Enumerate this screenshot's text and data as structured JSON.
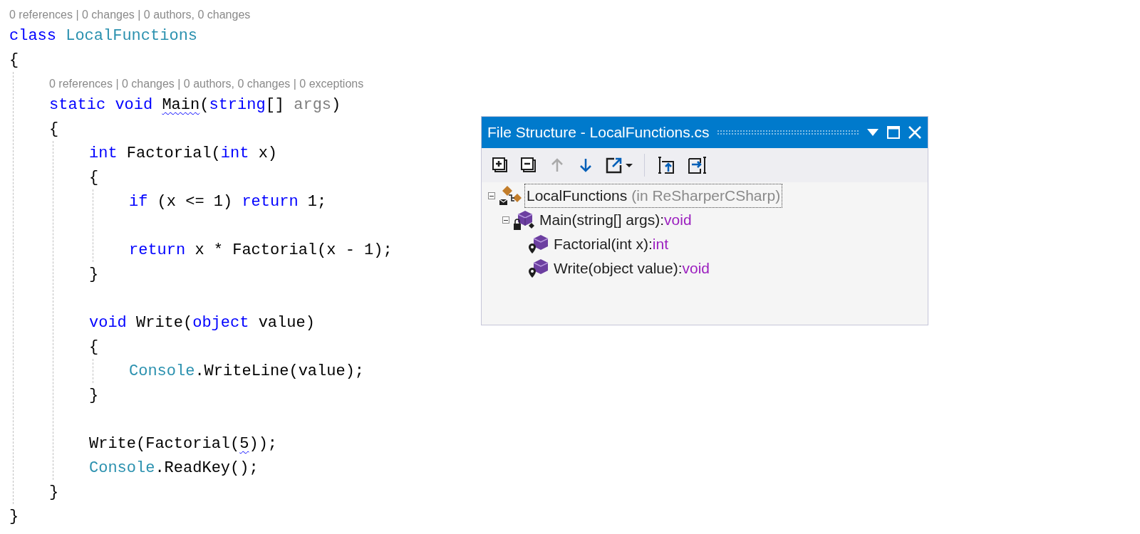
{
  "editor": {
    "lines": [
      {
        "kind": "lens",
        "text": "0 references | 0 changes | 0 authors, 0 changes"
      },
      {
        "kind": "code",
        "tokens": [
          {
            "text": "class",
            "kind": "keyword"
          },
          {
            "text": "LocalFunctions",
            "kind": "type",
            "space": true
          }
        ]
      },
      {
        "kind": "code",
        "tokens": [
          {
            "text": "{"
          }
        ]
      },
      {
        "kind": "block",
        "children": [
          {
            "kind": "lens",
            "text": "0 references | 0 changes | 0 authors, 0 changes | 0 exceptions"
          },
          {
            "kind": "code",
            "tokens": [
              {
                "text": "static void",
                "kind": "keyword"
              },
              {
                "text": "Main",
                "squiggle": true,
                "space": true
              },
              {
                "text": "("
              },
              {
                "text": "string",
                "kind": "keyword"
              },
              {
                "text": "[]"
              },
              {
                "text": "args",
                "kind": "unused",
                "space": true
              },
              {
                "text": ")"
              }
            ]
          },
          {
            "kind": "code",
            "tokens": [
              {
                "text": "{"
              }
            ]
          },
          {
            "kind": "block",
            "children": [
              {
                "kind": "code",
                "tokens": [
                  {
                    "text": "int",
                    "kind": "keyword"
                  },
                  {
                    "text": "Factorial(",
                    "space": true
                  },
                  {
                    "text": "int",
                    "kind": "keyword"
                  },
                  {
                    "text": "x)",
                    "space": true
                  }
                ]
              },
              {
                "kind": "code",
                "tokens": [
                  {
                    "text": "{"
                  }
                ]
              },
              {
                "kind": "block",
                "children": [
                  {
                    "kind": "code",
                    "tokens": [
                      {
                        "text": "if",
                        "kind": "keyword"
                      },
                      {
                        "text": "(x <= 1)",
                        "space": true
                      },
                      {
                        "text": "return",
                        "kind": "keyword",
                        "space": true
                      },
                      {
                        "text": "1;",
                        "space": true
                      }
                    ]
                  },
                  {
                    "kind": "blank"
                  },
                  {
                    "kind": "code",
                    "tokens": [
                      {
                        "text": "return",
                        "kind": "keyword"
                      },
                      {
                        "text": "x * Factorial(x - 1);",
                        "space": true
                      }
                    ]
                  }
                ]
              },
              {
                "kind": "code",
                "tokens": [
                  {
                    "text": "}"
                  }
                ]
              },
              {
                "kind": "blank"
              },
              {
                "kind": "code",
                "tokens": [
                  {
                    "text": "void",
                    "kind": "keyword"
                  },
                  {
                    "text": "Write(",
                    "space": true
                  },
                  {
                    "text": "object",
                    "kind": "keyword"
                  },
                  {
                    "text": "value)",
                    "space": true
                  }
                ]
              },
              {
                "kind": "code",
                "tokens": [
                  {
                    "text": "{"
                  }
                ]
              },
              {
                "kind": "block",
                "children": [
                  {
                    "kind": "code",
                    "tokens": [
                      {
                        "text": "Console",
                        "kind": "type"
                      },
                      {
                        "text": ".WriteLine(value);"
                      }
                    ]
                  }
                ]
              },
              {
                "kind": "code",
                "tokens": [
                  {
                    "text": "}"
                  }
                ]
              },
              {
                "kind": "blank"
              },
              {
                "kind": "code",
                "tokens": [
                  {
                    "text": "Write(Factorial("
                  },
                  {
                    "text": "5",
                    "squiggle": true
                  },
                  {
                    "text": "));"
                  }
                ]
              },
              {
                "kind": "code",
                "tokens": [
                  {
                    "text": "Console",
                    "kind": "type"
                  },
                  {
                    "text": ".ReadKey();"
                  }
                ]
              }
            ]
          },
          {
            "kind": "code",
            "tokens": [
              {
                "text": "}"
              }
            ]
          }
        ]
      },
      {
        "kind": "code",
        "tokens": [
          {
            "text": "}"
          }
        ]
      }
    ]
  },
  "file_structure": {
    "title": "File Structure - LocalFunctions.cs",
    "toolbar": [
      {
        "kind": "expand-all",
        "disabled": false
      },
      {
        "kind": "collapse-all",
        "disabled": false
      },
      {
        "kind": "move-up",
        "disabled": true
      },
      {
        "kind": "move-down",
        "disabled": false
      },
      {
        "kind": "export",
        "disabled": false
      },
      {
        "kind": "separator"
      },
      {
        "kind": "region-in",
        "disabled": false
      },
      {
        "kind": "region-out",
        "disabled": false
      }
    ],
    "tree": [
      {
        "kind": "class",
        "label": "LocalFunctions",
        "container": "(in ReSharperCSharp)",
        "expanded": true,
        "selected": true,
        "children": [
          {
            "kind": "method",
            "label": "Main(string[] args):",
            "return_type": "void",
            "expanded": true,
            "selected": false,
            "children": [
              {
                "kind": "local-function",
                "label": "Factorial(int x):",
                "return_type": "int",
                "selected": false
              },
              {
                "kind": "local-function",
                "label": "Write(object value):",
                "return_type": "void",
                "selected": false
              }
            ]
          }
        ]
      }
    ]
  }
}
